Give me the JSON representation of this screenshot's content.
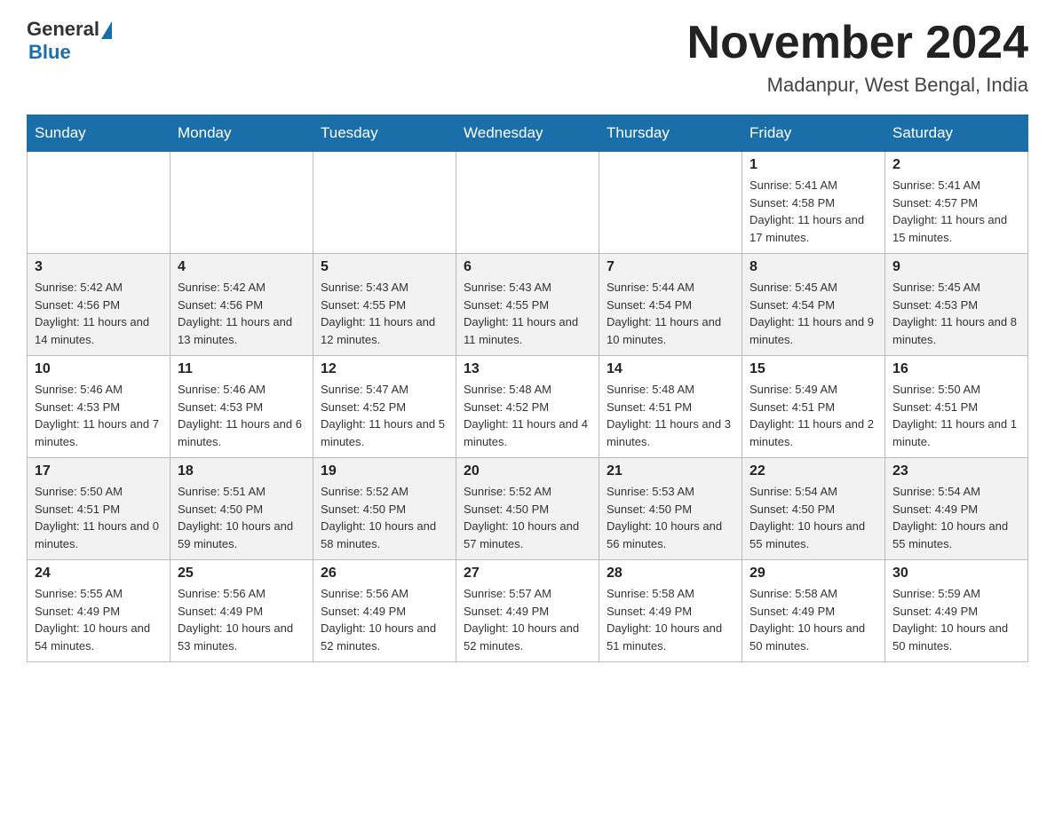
{
  "header": {
    "logo_general": "General",
    "logo_blue": "Blue",
    "month_year": "November 2024",
    "location": "Madanpur, West Bengal, India"
  },
  "weekdays": [
    "Sunday",
    "Monday",
    "Tuesday",
    "Wednesday",
    "Thursday",
    "Friday",
    "Saturday"
  ],
  "weeks": [
    [
      {
        "day": "",
        "sunrise": "",
        "sunset": "",
        "daylight": ""
      },
      {
        "day": "",
        "sunrise": "",
        "sunset": "",
        "daylight": ""
      },
      {
        "day": "",
        "sunrise": "",
        "sunset": "",
        "daylight": ""
      },
      {
        "day": "",
        "sunrise": "",
        "sunset": "",
        "daylight": ""
      },
      {
        "day": "",
        "sunrise": "",
        "sunset": "",
        "daylight": ""
      },
      {
        "day": "1",
        "sunrise": "Sunrise: 5:41 AM",
        "sunset": "Sunset: 4:58 PM",
        "daylight": "Daylight: 11 hours and 17 minutes."
      },
      {
        "day": "2",
        "sunrise": "Sunrise: 5:41 AM",
        "sunset": "Sunset: 4:57 PM",
        "daylight": "Daylight: 11 hours and 15 minutes."
      }
    ],
    [
      {
        "day": "3",
        "sunrise": "Sunrise: 5:42 AM",
        "sunset": "Sunset: 4:56 PM",
        "daylight": "Daylight: 11 hours and 14 minutes."
      },
      {
        "day": "4",
        "sunrise": "Sunrise: 5:42 AM",
        "sunset": "Sunset: 4:56 PM",
        "daylight": "Daylight: 11 hours and 13 minutes."
      },
      {
        "day": "5",
        "sunrise": "Sunrise: 5:43 AM",
        "sunset": "Sunset: 4:55 PM",
        "daylight": "Daylight: 11 hours and 12 minutes."
      },
      {
        "day": "6",
        "sunrise": "Sunrise: 5:43 AM",
        "sunset": "Sunset: 4:55 PM",
        "daylight": "Daylight: 11 hours and 11 minutes."
      },
      {
        "day": "7",
        "sunrise": "Sunrise: 5:44 AM",
        "sunset": "Sunset: 4:54 PM",
        "daylight": "Daylight: 11 hours and 10 minutes."
      },
      {
        "day": "8",
        "sunrise": "Sunrise: 5:45 AM",
        "sunset": "Sunset: 4:54 PM",
        "daylight": "Daylight: 11 hours and 9 minutes."
      },
      {
        "day": "9",
        "sunrise": "Sunrise: 5:45 AM",
        "sunset": "Sunset: 4:53 PM",
        "daylight": "Daylight: 11 hours and 8 minutes."
      }
    ],
    [
      {
        "day": "10",
        "sunrise": "Sunrise: 5:46 AM",
        "sunset": "Sunset: 4:53 PM",
        "daylight": "Daylight: 11 hours and 7 minutes."
      },
      {
        "day": "11",
        "sunrise": "Sunrise: 5:46 AM",
        "sunset": "Sunset: 4:53 PM",
        "daylight": "Daylight: 11 hours and 6 minutes."
      },
      {
        "day": "12",
        "sunrise": "Sunrise: 5:47 AM",
        "sunset": "Sunset: 4:52 PM",
        "daylight": "Daylight: 11 hours and 5 minutes."
      },
      {
        "day": "13",
        "sunrise": "Sunrise: 5:48 AM",
        "sunset": "Sunset: 4:52 PM",
        "daylight": "Daylight: 11 hours and 4 minutes."
      },
      {
        "day": "14",
        "sunrise": "Sunrise: 5:48 AM",
        "sunset": "Sunset: 4:51 PM",
        "daylight": "Daylight: 11 hours and 3 minutes."
      },
      {
        "day": "15",
        "sunrise": "Sunrise: 5:49 AM",
        "sunset": "Sunset: 4:51 PM",
        "daylight": "Daylight: 11 hours and 2 minutes."
      },
      {
        "day": "16",
        "sunrise": "Sunrise: 5:50 AM",
        "sunset": "Sunset: 4:51 PM",
        "daylight": "Daylight: 11 hours and 1 minute."
      }
    ],
    [
      {
        "day": "17",
        "sunrise": "Sunrise: 5:50 AM",
        "sunset": "Sunset: 4:51 PM",
        "daylight": "Daylight: 11 hours and 0 minutes."
      },
      {
        "day": "18",
        "sunrise": "Sunrise: 5:51 AM",
        "sunset": "Sunset: 4:50 PM",
        "daylight": "Daylight: 10 hours and 59 minutes."
      },
      {
        "day": "19",
        "sunrise": "Sunrise: 5:52 AM",
        "sunset": "Sunset: 4:50 PM",
        "daylight": "Daylight: 10 hours and 58 minutes."
      },
      {
        "day": "20",
        "sunrise": "Sunrise: 5:52 AM",
        "sunset": "Sunset: 4:50 PM",
        "daylight": "Daylight: 10 hours and 57 minutes."
      },
      {
        "day": "21",
        "sunrise": "Sunrise: 5:53 AM",
        "sunset": "Sunset: 4:50 PM",
        "daylight": "Daylight: 10 hours and 56 minutes."
      },
      {
        "day": "22",
        "sunrise": "Sunrise: 5:54 AM",
        "sunset": "Sunset: 4:50 PM",
        "daylight": "Daylight: 10 hours and 55 minutes."
      },
      {
        "day": "23",
        "sunrise": "Sunrise: 5:54 AM",
        "sunset": "Sunset: 4:49 PM",
        "daylight": "Daylight: 10 hours and 55 minutes."
      }
    ],
    [
      {
        "day": "24",
        "sunrise": "Sunrise: 5:55 AM",
        "sunset": "Sunset: 4:49 PM",
        "daylight": "Daylight: 10 hours and 54 minutes."
      },
      {
        "day": "25",
        "sunrise": "Sunrise: 5:56 AM",
        "sunset": "Sunset: 4:49 PM",
        "daylight": "Daylight: 10 hours and 53 minutes."
      },
      {
        "day": "26",
        "sunrise": "Sunrise: 5:56 AM",
        "sunset": "Sunset: 4:49 PM",
        "daylight": "Daylight: 10 hours and 52 minutes."
      },
      {
        "day": "27",
        "sunrise": "Sunrise: 5:57 AM",
        "sunset": "Sunset: 4:49 PM",
        "daylight": "Daylight: 10 hours and 52 minutes."
      },
      {
        "day": "28",
        "sunrise": "Sunrise: 5:58 AM",
        "sunset": "Sunset: 4:49 PM",
        "daylight": "Daylight: 10 hours and 51 minutes."
      },
      {
        "day": "29",
        "sunrise": "Sunrise: 5:58 AM",
        "sunset": "Sunset: 4:49 PM",
        "daylight": "Daylight: 10 hours and 50 minutes."
      },
      {
        "day": "30",
        "sunrise": "Sunrise: 5:59 AM",
        "sunset": "Sunset: 4:49 PM",
        "daylight": "Daylight: 10 hours and 50 minutes."
      }
    ]
  ]
}
